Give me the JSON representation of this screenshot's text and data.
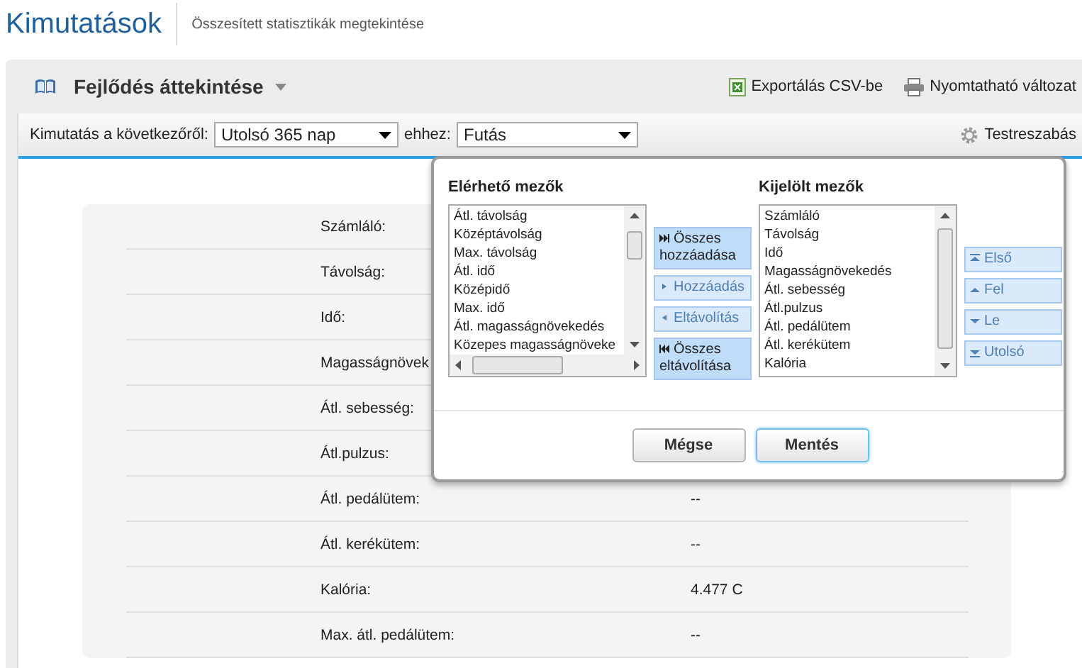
{
  "page_header": {
    "title": "Kimutatások",
    "subtitle": "Összesített statisztikák megtekintése"
  },
  "panel": {
    "title": "Fejlődés áttekintése",
    "actions": [
      {
        "kind": "csv",
        "label": "Exportálás CSV-be"
      },
      {
        "kind": "print",
        "label": "Nyomtatható változat"
      }
    ]
  },
  "filters": {
    "range_label": "Kimutatás a következőről:",
    "range_value": "Utolsó 365 nap",
    "activity_label": "ehhez:",
    "activity_value": "Futás",
    "customize": "Testreszabás"
  },
  "stats": [
    {
      "label": "Számláló:"
    },
    {
      "label": "Távolság:"
    },
    {
      "label": "Idő:"
    },
    {
      "label": "Magasságnövek"
    },
    {
      "label": "Átl. sebesség:"
    },
    {
      "label": "Átl.pulzus:"
    },
    {
      "label": "Átl. pedálütem:",
      "value": "--"
    },
    {
      "label": "Átl. kerékütem:",
      "value": "--"
    },
    {
      "label": "Kalória:",
      "value": "4.477 C"
    },
    {
      "label": "Max. átl. pedálütem:",
      "value": "--"
    }
  ],
  "dialog": {
    "available": {
      "title": "Elérhető mezők",
      "items": [
        "Átl. távolság",
        "Középtávolság",
        "Max. távolság",
        "Átl. idő",
        "Középidő",
        "Max. idő",
        "Átl. magasságnövekedés",
        "Közepes magasságnöveke"
      ]
    },
    "transfer_buttons": [
      {
        "kind": "add_all",
        "label": "Összes hozzáadása",
        "disabled": false
      },
      {
        "kind": "add",
        "label": "Hozzáadás",
        "disabled": true
      },
      {
        "kind": "remove",
        "label": "Eltávolítás",
        "disabled": true
      },
      {
        "kind": "remove_all",
        "label": "Összes eltávolítása",
        "disabled": false
      }
    ],
    "selected": {
      "title": "Kijelölt mezők",
      "items": [
        "Számláló",
        "Távolság",
        "Idő",
        "Magasságnövekedés",
        "Átl. sebesség",
        "Átl.pulzus",
        "Átl. pedálütem",
        "Átl. kerékütem",
        "Kalória"
      ]
    },
    "order_buttons": [
      {
        "kind": "first",
        "label": "Első",
        "disabled": true
      },
      {
        "kind": "up",
        "label": "Fel",
        "disabled": true
      },
      {
        "kind": "down",
        "label": "Le",
        "disabled": true
      },
      {
        "kind": "last",
        "label": "Utolsó",
        "disabled": true
      }
    ],
    "cancel": "Mégse",
    "save": "Mentés"
  }
}
